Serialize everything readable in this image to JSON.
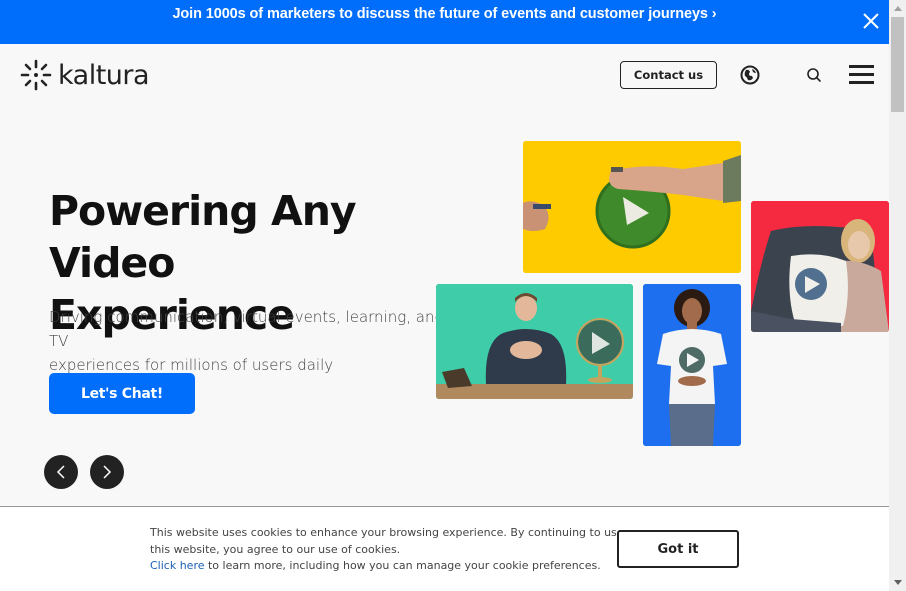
{
  "banner": {
    "text": "Join 1000s of marketers to discuss the future of events and customer journeys ›",
    "close_icon": "close-icon",
    "color": "#006efa"
  },
  "header": {
    "logo_text": "kaltura",
    "contact_label": "Contact us",
    "icons": [
      "globe-icon",
      "search-icon",
      "hamburger-menu-icon"
    ]
  },
  "hero": {
    "title_line1": "Powering Any Video",
    "title_line2": "Experience",
    "subtitle_line1": "Driving communication, virtual events, learning, and TV",
    "subtitle_line2": "experiences for millions of users daily",
    "cta_label": "Let's Chat!",
    "cta_color": "#006efa",
    "prev_icon": "chevron-left-icon",
    "next_icon": "chevron-right-icon",
    "tiles": [
      {
        "name": "yellow-whiteboard-play-image",
        "bg": "#fdcb00"
      },
      {
        "name": "red-couch-woman-image",
        "bg": "#f5293f"
      },
      {
        "name": "green-presenter-globe-image",
        "bg": "#3ecda8"
      },
      {
        "name": "blue-woman-tshirt-image",
        "bg": "#1e6ef0"
      }
    ]
  },
  "cookie": {
    "line1": "This website uses cookies to enhance your browsing experience. By continuing to use",
    "line2": "this website, you agree to our use of cookies.",
    "link": "Click here",
    "line3": " to learn more, including how you can manage your cookie preferences.",
    "button": "Got it"
  }
}
